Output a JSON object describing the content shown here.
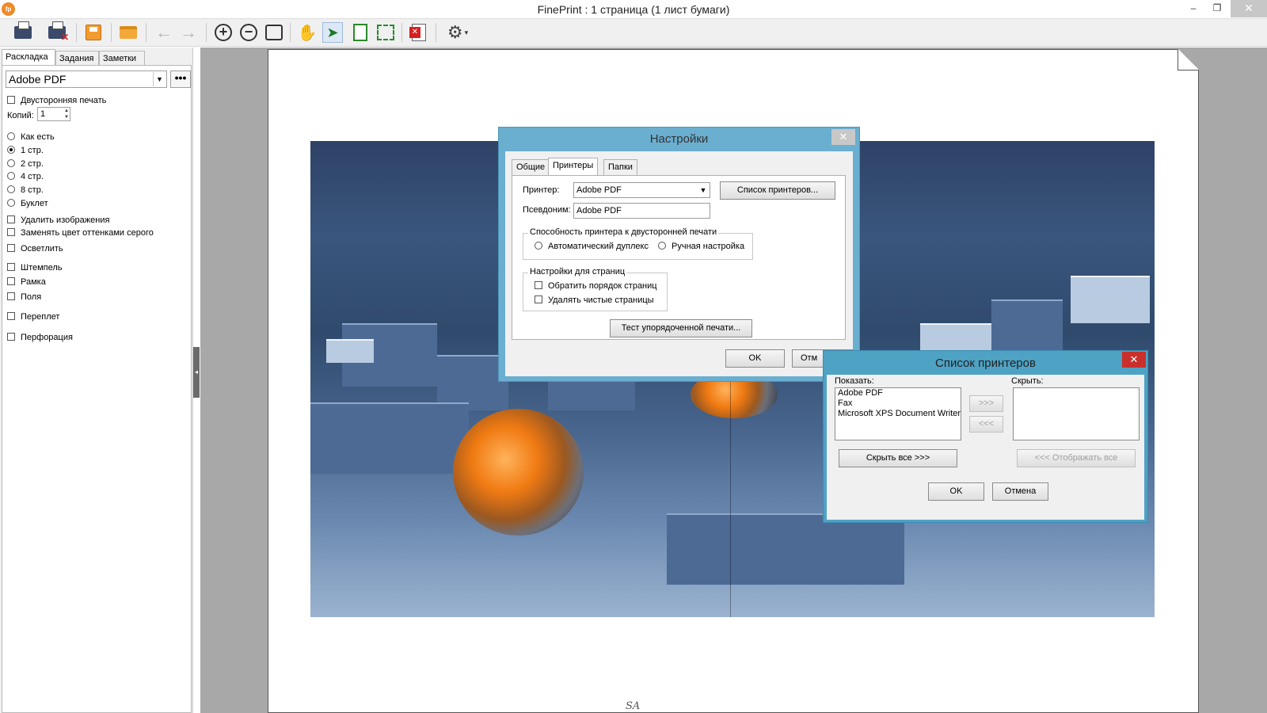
{
  "window": {
    "title": "FinePrint : 1 страница (1 лист бумаги)",
    "app_icon_text": "fp",
    "minimize": "–",
    "restore": "❐",
    "close": "✕"
  },
  "toolbar": {
    "zoom_in": "+",
    "zoom_out": "−",
    "back": "←",
    "forward": "→",
    "pointer": "➤",
    "hand": "✋",
    "gear": "⚙",
    "gear_caret": "▾"
  },
  "left_panel": {
    "tabs": [
      "Раскладка",
      "Задания",
      "Заметки"
    ],
    "printer": "Adobe PDF",
    "more_label": "•••",
    "duplex": "Двусторонняя печать",
    "copies_label": "Копий:",
    "copies_value": "1",
    "layouts": [
      "Как есть",
      "1 стр.",
      "2 стр.",
      "4 стр.",
      "8 стр.",
      "Буклет"
    ],
    "selected_layout": 1,
    "options": {
      "remove_images": "Удалить изображения",
      "grayscale": "Заменять цвет оттенками серого",
      "lighten": "Осветлить",
      "stamp": "Штемпель",
      "frame": "Рамка",
      "margins": "Поля",
      "binding": "Переплет",
      "punch": "Перфорация"
    }
  },
  "page": {
    "signature": "SA"
  },
  "settings_dialog": {
    "title": "Настройки",
    "close": "✕",
    "tabs": [
      "Общие",
      "Принтеры",
      "Папки"
    ],
    "active_tab": "Принтеры",
    "printer_label": "Принтер:",
    "printer_value": "Adobe PDF",
    "printer_list_button": "Список принтеров...",
    "alias_label": "Псевдоним:",
    "alias_value": "Adobe PDF",
    "duplex_group": "Способность принтера к двусторонней печати",
    "duplex_auto": "Автоматический дуплекс",
    "duplex_manual": "Ручная настройка",
    "pages_group": "Настройки для страниц",
    "reverse_order": "Обратить порядок страниц",
    "remove_blank": "Удалять чистые страницы",
    "test_button": "Тест упорядоченной печати...",
    "ok": "OK",
    "cancel_partial": "Отм"
  },
  "printers_dialog": {
    "title": "Список принтеров",
    "close": "✕",
    "show_label": "Показать:",
    "hide_label": "Скрыть:",
    "show_items": [
      "Adobe PDF",
      "Fax",
      "Microsoft XPS Document Writer"
    ],
    "move_right": ">>>",
    "move_left": "<<<",
    "hide_all": "Скрыть все  >>>",
    "show_all": "<<<  Отображать все",
    "ok": "OK",
    "cancel": "Отмена"
  }
}
